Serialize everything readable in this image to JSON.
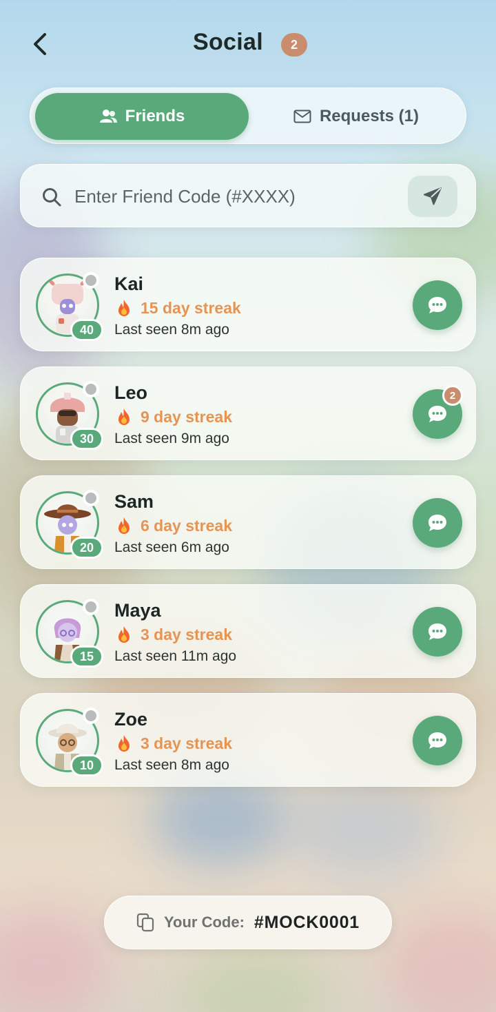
{
  "header": {
    "title": "Social",
    "badge_count": "2",
    "back_icon": "chevron-left-icon"
  },
  "tabs": {
    "friends": {
      "label": "Friends",
      "icon": "users-icon",
      "active": true
    },
    "requests": {
      "label": "Requests (1)",
      "icon": "mail-icon",
      "active": false
    }
  },
  "search": {
    "placeholder": "Enter Friend Code (#XXXX)",
    "value": "",
    "icon": "search-icon",
    "send_icon": "send-icon"
  },
  "friends": [
    {
      "name": "Kai",
      "level": "40",
      "streak": "15 day streak",
      "last_seen": "Last seen 8m ago",
      "unread": "",
      "avatar": "robot-helmet-avatar"
    },
    {
      "name": "Leo",
      "level": "30",
      "streak": "9 day streak",
      "last_seen": "Last seen 9m ago",
      "unread": "2",
      "avatar": "pink-helmet-avatar"
    },
    {
      "name": "Sam",
      "level": "20",
      "streak": "6 day streak",
      "last_seen": "Last seen 6m ago",
      "unread": "",
      "avatar": "cowboy-hat-avatar"
    },
    {
      "name": "Maya",
      "level": "15",
      "streak": "3 day streak",
      "last_seen": "Last seen 11m ago",
      "unread": "",
      "avatar": "purple-hair-avatar"
    },
    {
      "name": "Zoe",
      "level": "10",
      "streak": "3 day streak",
      "last_seen": "Last seen 8m ago",
      "unread": "",
      "avatar": "bucket-hat-avatar"
    }
  ],
  "your_code": {
    "label": "Your Code:",
    "value": "#MOCK0001",
    "icon": "copy-icon"
  },
  "colors": {
    "accent_green": "#5aa97a",
    "streak_orange": "#e69453",
    "badge_brown": "#c98d6e",
    "status_offline": "#b9bcbc"
  }
}
